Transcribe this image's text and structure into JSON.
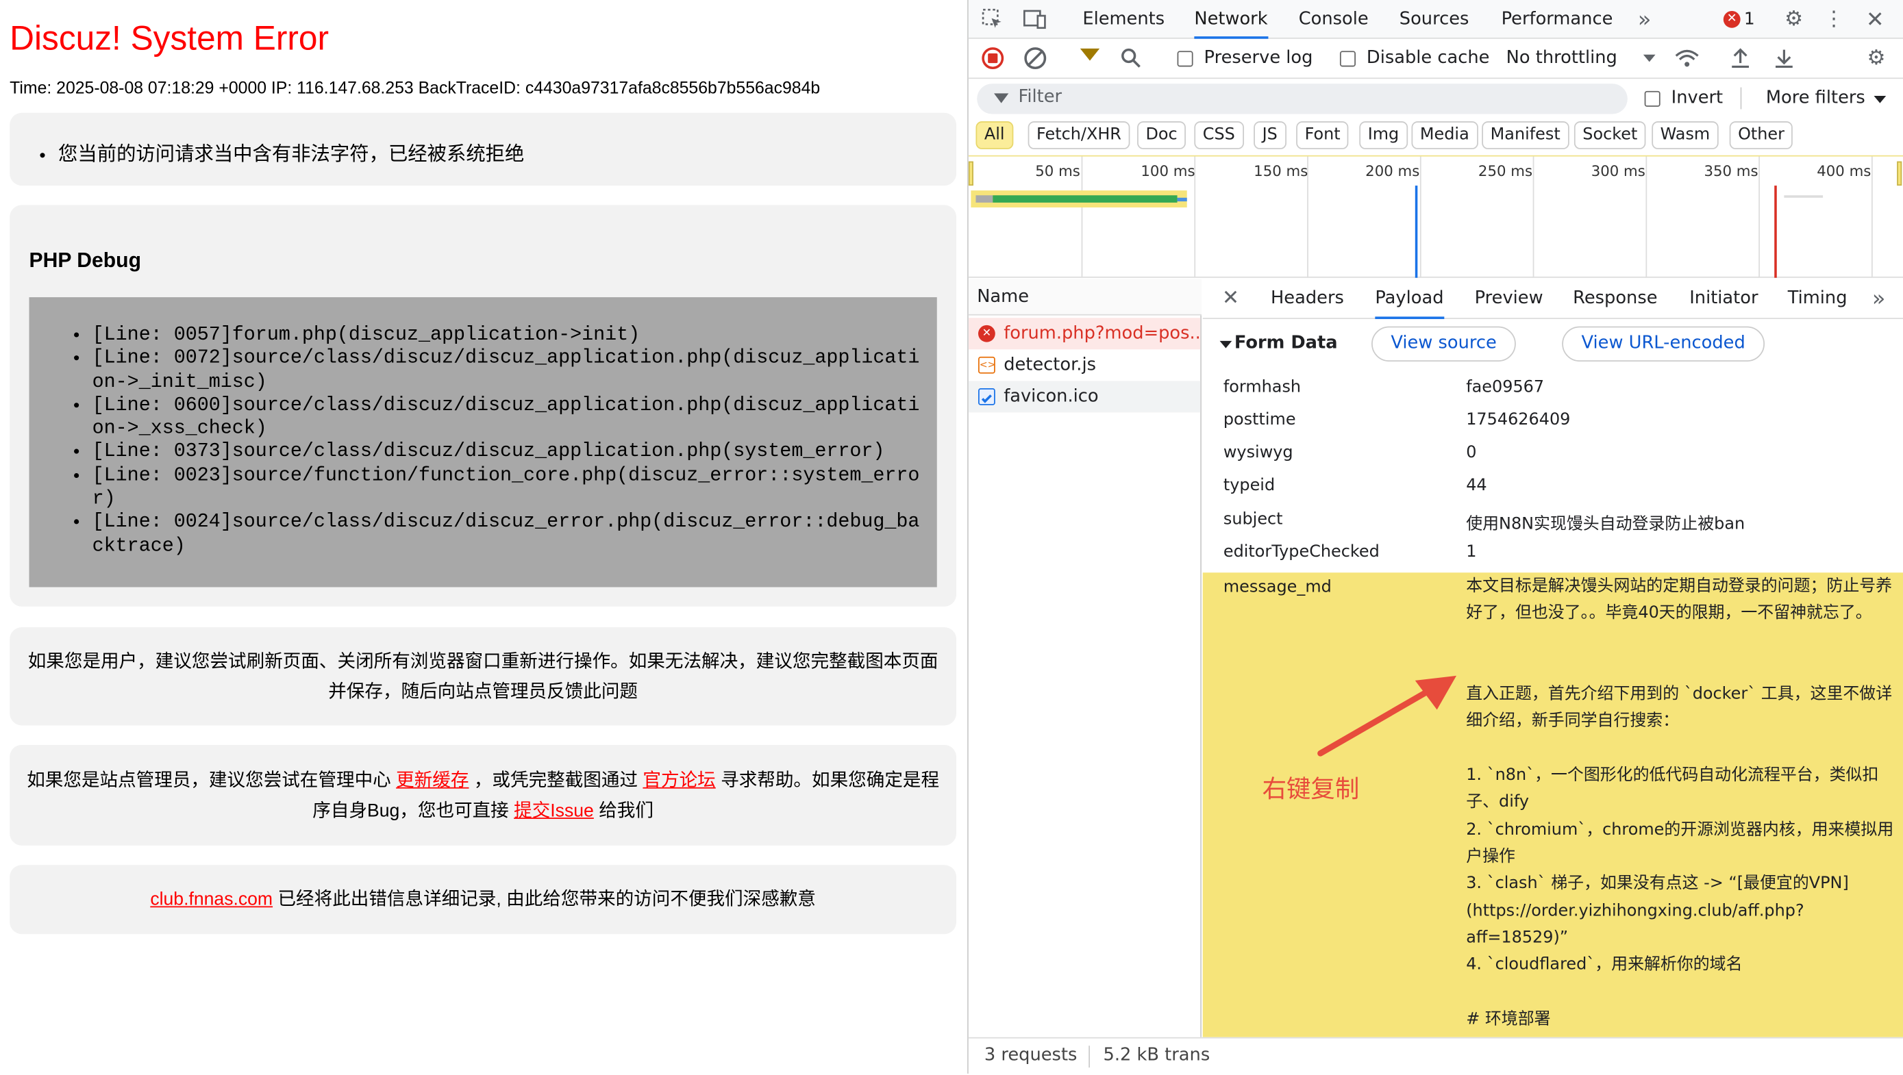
{
  "page": {
    "title": "Discuz! System Error",
    "meta": "Time: 2025-08-08 07:18:29 +0000 IP: 116.147.68.253 BackTraceID: c4430a97317afa8c8556b7b556ac984b",
    "error_message": "您当前的访问请求当中含有非法字符，已经被系统拒绝",
    "debug_heading": "PHP Debug",
    "trace": [
      "[Line: 0057]forum.php(discuz_application->init)",
      "[Line: 0072]source/class/discuz/discuz_application.php(discuz_application->_init_misc)",
      "[Line: 0600]source/class/discuz/discuz_application.php(discuz_application->_xss_check)",
      "[Line: 0373]source/class/discuz/discuz_application.php(system_error)",
      "[Line: 0023]source/function/function_core.php(discuz_error::system_error)",
      "[Line: 0024]source/class/discuz/discuz_error.php(discuz_error::debug_backtrace)"
    ],
    "user_msg": "如果您是用户，建议您尝试刷新页面、关闭所有浏览器窗口重新进行操作。如果无法解决，建议您完整截图本页面并保存，随后向站点管理员反馈此问题",
    "admin_msg": {
      "p1": "如果您是站点管理员，建议您尝试在管理中心 ",
      "link1": "更新缓存",
      "p2": " ，或凭完整截图通过 ",
      "link2": "官方论坛",
      "p3": " 寻求帮助。如果您确定是程序自身Bug，您也可直接 ",
      "link3": "提交Issue",
      "p4": " 给我们"
    },
    "footer": {
      "link": "club.fnnas.com",
      "text": " 已经将此出错信息详细记录, 由此给您带来的访问不便我们深感歉意"
    }
  },
  "devtools": {
    "tabs": [
      "Elements",
      "Network",
      "Console",
      "Sources",
      "Performance"
    ],
    "active_tab": "Network",
    "error_count": "1",
    "toolbar": {
      "preserve_log": "Preserve log",
      "disable_cache": "Disable cache",
      "throttling": "No throttling"
    },
    "filter": {
      "placeholder": "Filter",
      "invert": "Invert",
      "more_filters": "More filters"
    },
    "types": [
      "All",
      "Fetch/XHR",
      "Doc",
      "CSS",
      "JS",
      "Font",
      "Img",
      "Media",
      "Manifest",
      "Socket",
      "Wasm",
      "Other"
    ],
    "timeline_ticks": [
      "50 ms",
      "100 ms",
      "150 ms",
      "200 ms",
      "250 ms",
      "300 ms",
      "350 ms",
      "400 ms"
    ],
    "name_header": "Name",
    "requests": [
      "forum.php?mod=pos...",
      "detector.js",
      "favicon.ico"
    ],
    "status": {
      "requests": "3 requests",
      "transferred": "5.2 kB trans"
    },
    "detail_tabs": [
      "Headers",
      "Payload",
      "Preview",
      "Response",
      "Initiator",
      "Timing"
    ],
    "active_detail_tab": "Payload",
    "form_data_title": "Form Data",
    "view_source": "View source",
    "view_url_encoded": "View URL-encoded",
    "form_fields": [
      {
        "key": "formhash",
        "value": "fae09567"
      },
      {
        "key": "posttime",
        "value": "1754626409"
      },
      {
        "key": "wysiwyg",
        "value": "0"
      },
      {
        "key": "typeid",
        "value": "44"
      },
      {
        "key": "subject",
        "value": "使用N8N实现馒头自动登录防止被ban"
      },
      {
        "key": "editorTypeChecked",
        "value": "1"
      }
    ],
    "message_key": "message_md",
    "message_value": "本文目标是解决馒头网站的定期自动登录的问题；防止号养好了，但也没了。。毕竟40天的限期，一不留神就忘了。\n\n\n直入正题，首先介绍下用到的 `docker` 工具，这里不做详细介绍，新手同学自行搜索：\n\n1. `n8n`，一个图形化的低代码自动化流程平台，类似扣子、dify\n2. `chromium`，chrome的开源浏览器内核，用来模拟用户操作\n3. `clash` 梯子，如果没有点这 -> “[最便宜的VPN](https://order.yizhihongxing.club/aff.php?aff=18529)”\n4. `cloudflared`，用来解析你的域名\n\n# 环境部署\n\n环境部署使用 `docker compose` 方式，具体配置如下。"
  },
  "annotation": "右键复制",
  "colors": {
    "error_red": "#ff0000",
    "devtools_accent": "#1a73e8",
    "highlight_yellow": "#f6e47a"
  }
}
